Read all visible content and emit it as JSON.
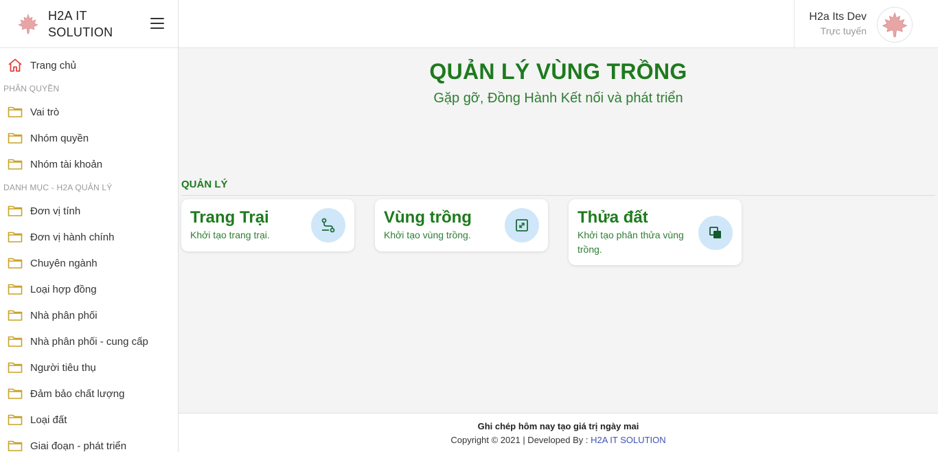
{
  "brand": {
    "line1": "H2A IT",
    "line2": "SOLUTION"
  },
  "user": {
    "name": "H2a Its Dev",
    "status": "Trực tuyến"
  },
  "sidebar": {
    "home": "Trang chủ",
    "section1": "PHÂN QUYỀN",
    "group1": [
      "Vai trò",
      "Nhóm quyền",
      "Nhóm tài khoản"
    ],
    "section2": "DANH MỤC - H2A QUẢN LÝ",
    "group2": [
      "Đơn vị tính",
      "Đơn vị hành chính",
      "Chuyên ngành",
      "Loại hợp đồng",
      "Nhà phân phối",
      "Nhà phân phối - cung cấp",
      "Người tiêu thụ",
      "Đảm bảo chất lượng",
      "Loại đất",
      "Giai đoạn - phát triển"
    ]
  },
  "main": {
    "title": "QUẢN LÝ VÙNG TRỒNG",
    "subtitle": "Gặp gỡ, Đồng Hành Kết nối và phát triển",
    "section": "QUẢN LÝ",
    "cards": [
      {
        "title": "Trang Trại",
        "desc": "Khởi tạo trang trại.",
        "icon": "route-icon"
      },
      {
        "title": "Vùng trồng",
        "desc": "Khởi tạo vùng trồng.",
        "icon": "area-icon"
      },
      {
        "title": "Thửa đất",
        "desc": "Khởi tạo phân thửa vùng trồng.",
        "icon": "layers-icon"
      }
    ]
  },
  "footer": {
    "slogan": "Ghi chép hôm nay tạo giá trị ngày mai",
    "copyright": "Copyright © 2021 | Developed By : ",
    "company": "H2A IT SOLUTION"
  },
  "colors": {
    "primary_green": "#1e7a1e",
    "icon_bg": "#cfe7f8",
    "folder": "#c9a227",
    "home_icon": "#e53935",
    "link": "#3f51b5"
  }
}
